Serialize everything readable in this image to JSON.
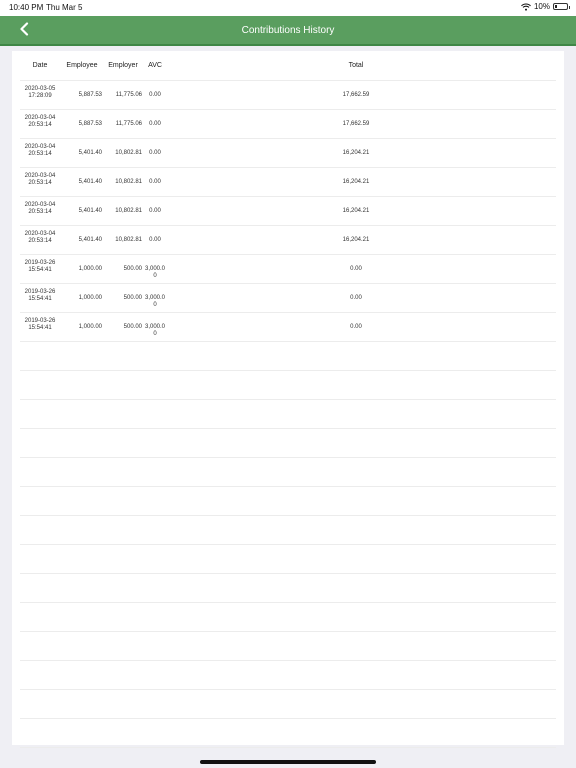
{
  "status": {
    "time": "10:40 PM",
    "date": "Thu Mar 5",
    "battery": "10%"
  },
  "nav": {
    "title": "Contributions History",
    "back_icon": "chevron-left-icon"
  },
  "table": {
    "headers": {
      "date": "Date",
      "employee": "Employee",
      "employer": "Employer",
      "avc": "AVC",
      "total": "Total"
    },
    "rows": [
      {
        "date_line1": "2020-03-05",
        "date_line2": "17:28:09",
        "employee": "5,887.53",
        "employer": "11,775.06",
        "avc_line1": "0.00",
        "avc_line2": "",
        "total": "17,662.59"
      },
      {
        "date_line1": "2020-03-04",
        "date_line2": "20:53:14",
        "employee": "5,887.53",
        "employer": "11,775.06",
        "avc_line1": "0.00",
        "avc_line2": "",
        "total": "17,662.59"
      },
      {
        "date_line1": "2020-03-04",
        "date_line2": "20:53:14",
        "employee": "5,401.40",
        "employer": "10,802.81",
        "avc_line1": "0.00",
        "avc_line2": "",
        "total": "16,204.21"
      },
      {
        "date_line1": "2020-03-04",
        "date_line2": "20:53:14",
        "employee": "5,401.40",
        "employer": "10,802.81",
        "avc_line1": "0.00",
        "avc_line2": "",
        "total": "16,204.21"
      },
      {
        "date_line1": "2020-03-04",
        "date_line2": "20:53:14",
        "employee": "5,401.40",
        "employer": "10,802.81",
        "avc_line1": "0.00",
        "avc_line2": "",
        "total": "16,204.21"
      },
      {
        "date_line1": "2020-03-04",
        "date_line2": "20:53:14",
        "employee": "5,401.40",
        "employer": "10,802.81",
        "avc_line1": "0.00",
        "avc_line2": "",
        "total": "16,204.21"
      },
      {
        "date_line1": "2019-03-26",
        "date_line2": "15:54:41",
        "employee": "1,000.00",
        "employer": "500.00",
        "avc_line1": "3,000.0",
        "avc_line2": "0",
        "total": "0.00"
      },
      {
        "date_line1": "2019-03-26",
        "date_line2": "15:54:41",
        "employee": "1,000.00",
        "employer": "500.00",
        "avc_line1": "3,000.0",
        "avc_line2": "0",
        "total": "0.00"
      },
      {
        "date_line1": "2019-03-26",
        "date_line2": "15:54:41",
        "employee": "1,000.00",
        "employer": "500.00",
        "avc_line1": "3,000.0",
        "avc_line2": "0",
        "total": "0.00"
      }
    ]
  }
}
